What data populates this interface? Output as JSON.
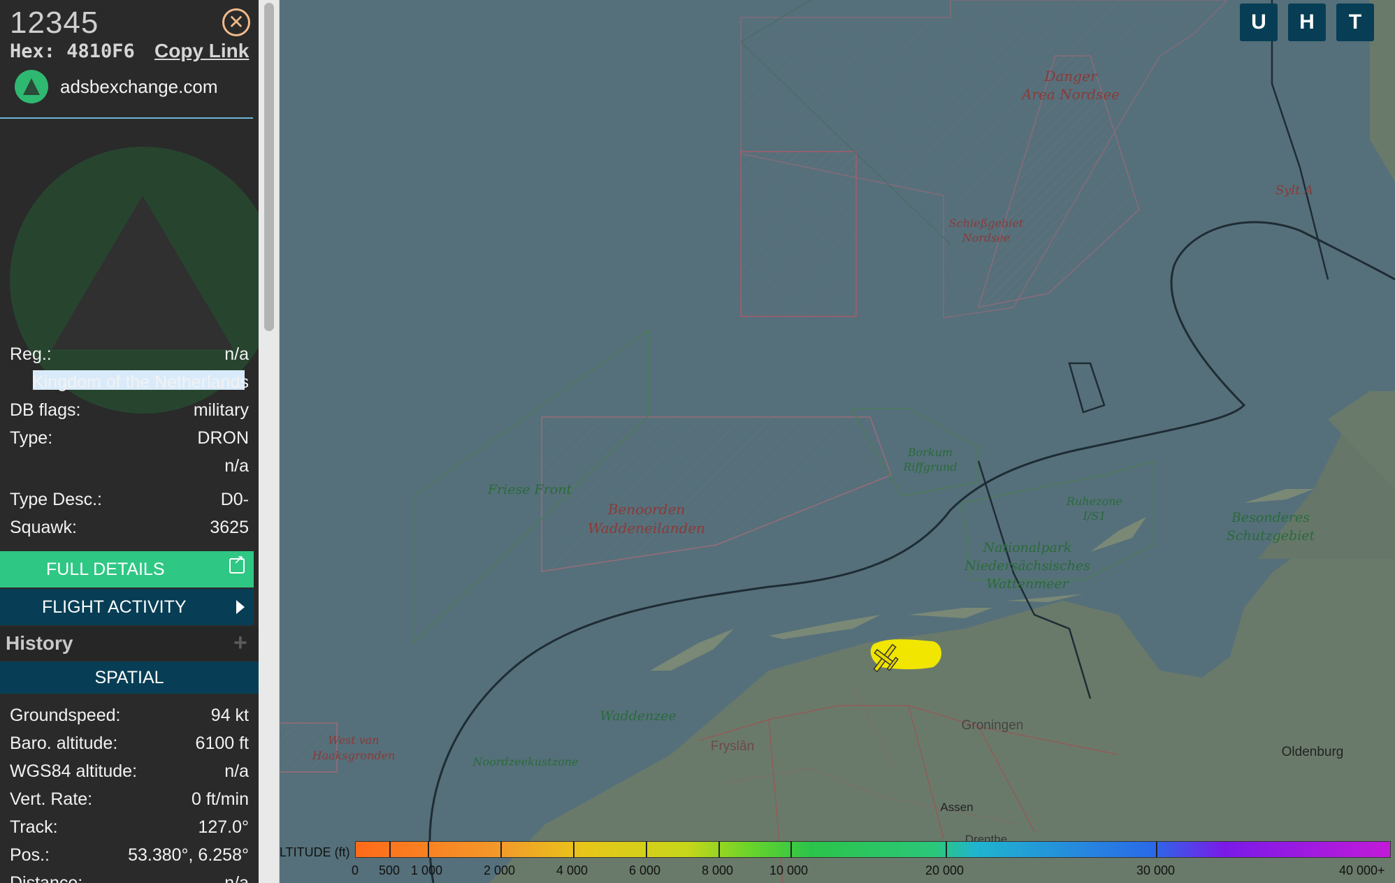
{
  "aircraft": {
    "callsign": "12345",
    "hex_text": "Hex: 4810F6",
    "copy_link": "Copy Link",
    "source": "adsbexchange.com"
  },
  "details": {
    "reg_label": "Reg.:",
    "reg_value": "n/a",
    "country": "Kingdom of the Netherlands",
    "db_flags_label": "DB flags:",
    "db_flags_value": "military",
    "type_label": "Type:",
    "type_value": "DRON",
    "type_extra": "n/a",
    "type_desc_label": "Type Desc.:",
    "type_desc_value": "D0-",
    "squawk_label": "Squawk:",
    "squawk_value": "3625"
  },
  "buttons": {
    "full_details": "FULL DETAILS",
    "flight_activity": "FLIGHT ACTIVITY",
    "history": "History",
    "spatial": "SPATIAL"
  },
  "spatial": {
    "groundspeed_label": "Groundspeed:",
    "groundspeed_value": "94 kt",
    "baro_label": "Baro. altitude:",
    "baro_value": "6100 ft",
    "wgs_label": "WGS84 altitude:",
    "wgs_value": "n/a",
    "vert_label": "Vert. Rate:",
    "vert_value": "0 ft/min",
    "track_label": "Track:",
    "track_value": "127.0°",
    "pos_label": "Pos.:",
    "pos_value": "53.380°, 6.258°",
    "distance_label": "Distance:",
    "distance_value": "n/a"
  },
  "map_buttons": {
    "u": "U",
    "h": "H",
    "t": "T"
  },
  "map_labels": {
    "danger_area": [
      "Danger",
      "Area Nordsee"
    ],
    "schiessgebiet": [
      "Schießgebiet",
      "Nordsee"
    ],
    "sylt": "Sylt A",
    "friese_front": "Friese Front",
    "benoorden": [
      "Benoorden",
      "Waddeneilanden"
    ],
    "borkum": [
      "Borkum",
      "Riffgrund"
    ],
    "ruhezone": [
      "Ruhezone",
      "I/S1"
    ],
    "besonderes": [
      "Besonderes",
      "Schutzgebiet"
    ],
    "nationalpark": [
      "Nationalpark",
      "Niedersächsisches",
      "Wattenmeer"
    ],
    "waddenzee": "Waddenzee",
    "west_van": [
      "West van",
      "Haaksgronden"
    ],
    "noordzeekust": "Noordzeekustzone",
    "fryslan": "Fryslân",
    "groningen": "Groningen",
    "oldenburg": "Oldenburg",
    "assen": "Assen",
    "drenthe": "Drenthe"
  },
  "altitude_legend": {
    "title": "LTITUDE (ft)",
    "labels": [
      "0",
      "500",
      "1 000",
      "2 000",
      "4 000",
      "6 000",
      "8 000",
      "10 000",
      "20 000",
      "30 000",
      "40 000+"
    ]
  },
  "colors": {
    "sidebar_bg": "#2a2a2a",
    "full_details_bg": "#2fc784",
    "dark_button_bg": "#073e55",
    "aircraft_track": "#f0e600"
  }
}
